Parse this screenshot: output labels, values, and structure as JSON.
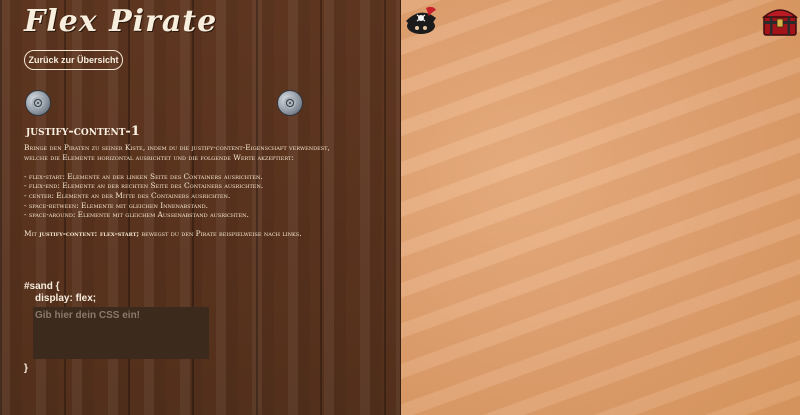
{
  "app": {
    "title": "Flex Pirate"
  },
  "nav": {
    "back_label": "Zurück zur Übersicht"
  },
  "level": {
    "title": "justify-content-1",
    "intro": "Bringe den Piraten zu seiner Kiste, indem du die justify-content-Eigenschaft verwendest, welche die Elemente horizontal ausrichtet und die folgende Werte akzeptiert:",
    "options": [
      "flex-start: Elemente an der linken Seite des Containers ausrichten.",
      "flex-end: Elemente an der rechten Seite des Containers ausrichten.",
      "center: Elemente an der Mitte des Containers ausrichten.",
      "space-between: Elemente mit gleichen Innenabstand.",
      "space-around: Elemente mit gleichem Außenabstand ausrichten."
    ],
    "example_prefix": "Mit",
    "example_code": "justify-content: flex-start;",
    "example_suffix": "bewegst du den Pirate beispielweise nach links."
  },
  "editor": {
    "selector_line": "#sand {",
    "display_line": "display: flex;",
    "placeholder": "Gib hier dein CSS ein!",
    "closing_brace": "}"
  },
  "icons": {
    "prev_level": "coin-prev-icon",
    "next_level": "coin-next-icon",
    "pirate": "pirate-icon",
    "chest": "treasure-chest-icon"
  },
  "colors": {
    "wood": "#5a331e",
    "sand": "#dfa06f",
    "input_bg": "#3c2a1d"
  }
}
